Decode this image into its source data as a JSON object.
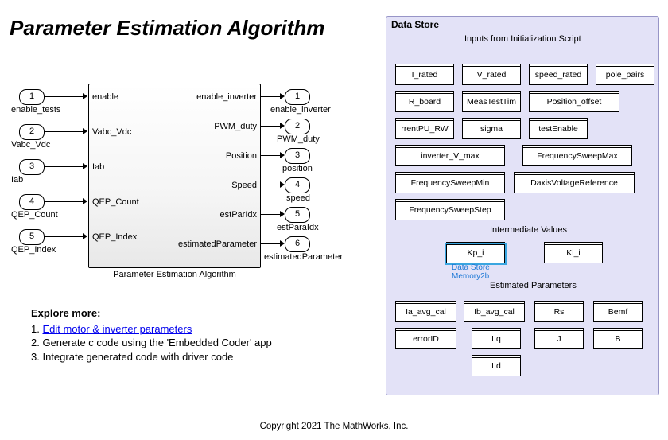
{
  "title": "Parameter Estimation Algorithm",
  "block": {
    "name": "Parameter Estimation Algorithm",
    "inports": [
      {
        "idx": "1",
        "name": "enable_tests",
        "port_label": "enable"
      },
      {
        "idx": "2",
        "name": "Vabc_Vdc",
        "port_label": "Vabc_Vdc"
      },
      {
        "idx": "3",
        "name": "Iab",
        "port_label": "Iab"
      },
      {
        "idx": "4",
        "name": "QEP_Count",
        "port_label": "QEP_Count"
      },
      {
        "idx": "5",
        "name": "QEP_Index",
        "port_label": "QEP_Index"
      }
    ],
    "outports": [
      {
        "idx": "1",
        "name": "enable_inverter",
        "port_label": "enable_inverter"
      },
      {
        "idx": "2",
        "name": "PWM_duty",
        "port_label": "PWM_duty"
      },
      {
        "idx": "3",
        "name": "position",
        "port_label": "Position"
      },
      {
        "idx": "4",
        "name": "speed",
        "port_label": "Speed"
      },
      {
        "idx": "5",
        "name": "estParaIdx",
        "port_label": "estParIdx"
      },
      {
        "idx": "6",
        "name": "estimatedParameter",
        "port_label": "estimatedParameter"
      }
    ]
  },
  "explore": {
    "header": "Explore more:",
    "items": [
      {
        "prefix": "1. ",
        "link": "Edit motor & inverter parameters",
        "suffix": ""
      },
      {
        "prefix": "2. ",
        "link": "",
        "suffix": "Generate c code using the 'Embedded Coder' app"
      },
      {
        "prefix": "3. ",
        "link": "",
        "suffix": "Integrate generated code with driver code"
      }
    ]
  },
  "datastore": {
    "title": "Data Store",
    "sections": {
      "inputs": "Inputs from Initialization Script",
      "intermediate": "Intermediate Values",
      "estimated": "Estimated Parameters",
      "selected_caption": "Data Store\nMemory2b"
    },
    "inputs_blocks": [
      "I_rated",
      "V_rated",
      "speed_rated",
      "pole_pairs",
      "R_board",
      "MeasTestTim",
      "Position_offset",
      "rrentPU_RW",
      "sigma",
      "testEnable",
      "inverter_V_max",
      "FrequencySweepMax",
      "FrequencySweepMin",
      "DaxisVoltageReference",
      "FrequencySweepStep"
    ],
    "intermediate_blocks": [
      "Kp_i",
      "Ki_i"
    ],
    "estimated_blocks": [
      "Ia_avg_cal",
      "Ib_avg_cal",
      "Rs",
      "Bemf",
      "errorID",
      "Lq",
      "J",
      "B",
      "Ld"
    ]
  },
  "copyright": "Copyright 2021 The MathWorks, Inc."
}
